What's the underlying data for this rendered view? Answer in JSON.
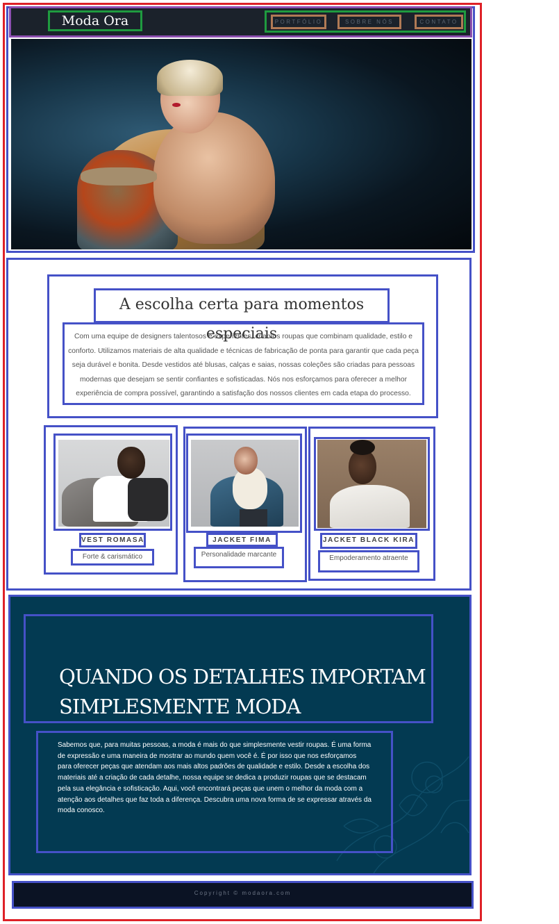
{
  "header": {
    "brand": "Moda Ora",
    "nav": [
      "PORTFÓLIO",
      "SOBRE NÓS",
      "CONTATO"
    ]
  },
  "intro": {
    "title": "A escolha certa para momentos especiais",
    "body": "Com uma equipe de designers talentosos e experientes, criamos roupas que combinam qualidade, estilo e conforto. Utilizamos materiais de alta qualidade e técnicas de fabricação de ponta para garantir que cada peça seja durável e bonita. Desde vestidos até blusas, calças e saias, nossas coleções são criadas para pessoas modernas que desejam se sentir confiantes e sofisticadas. Nós nos esforçamos para oferecer a melhor experiência de compra possível, garantindo a satisfação dos nossos clientes em cada etapa do processo."
  },
  "products": [
    {
      "title": "VEST ROMASA",
      "subtitle": "Forte & carismático"
    },
    {
      "title": "JACKET FIMA",
      "subtitle": "Personalidade marcante"
    },
    {
      "title": "JACKET BLACK KIRA",
      "subtitle": "Empoderamento atraente"
    }
  ],
  "feature": {
    "heading_line1": "QUANDO OS DETALHES IMPORTAM",
    "heading_line2": "SIMPLESMENTE MODA",
    "body": "Sabemos que, para muitas pessoas, a moda é mais do que simplesmente vestir roupas. É uma forma de expressão e uma maneira de mostrar ao mundo quem você é. É por isso que nos esforçamos para oferecer peças que atendam aos mais altos padrões de qualidade e estilo. Desde a escolha dos materiais até a criação de cada detalhe, nossa equipe se dedica a produzir roupas que se destacam pela sua elegância e sofisticação. Aqui, você encontrará peças que unem o melhor da moda com a atenção aos detalhes que faz toda a diferença. Descubra uma nova forma de se expressar através da moda conosco."
  },
  "footer": {
    "copyright": "Copyright © modaora.com"
  },
  "colors": {
    "header_bg": "#1b222b",
    "feature_bg": "#033a52",
    "footer_bg": "#0b1324",
    "annotation_outer": "#de2127",
    "annotation_box": "#4551c7"
  }
}
